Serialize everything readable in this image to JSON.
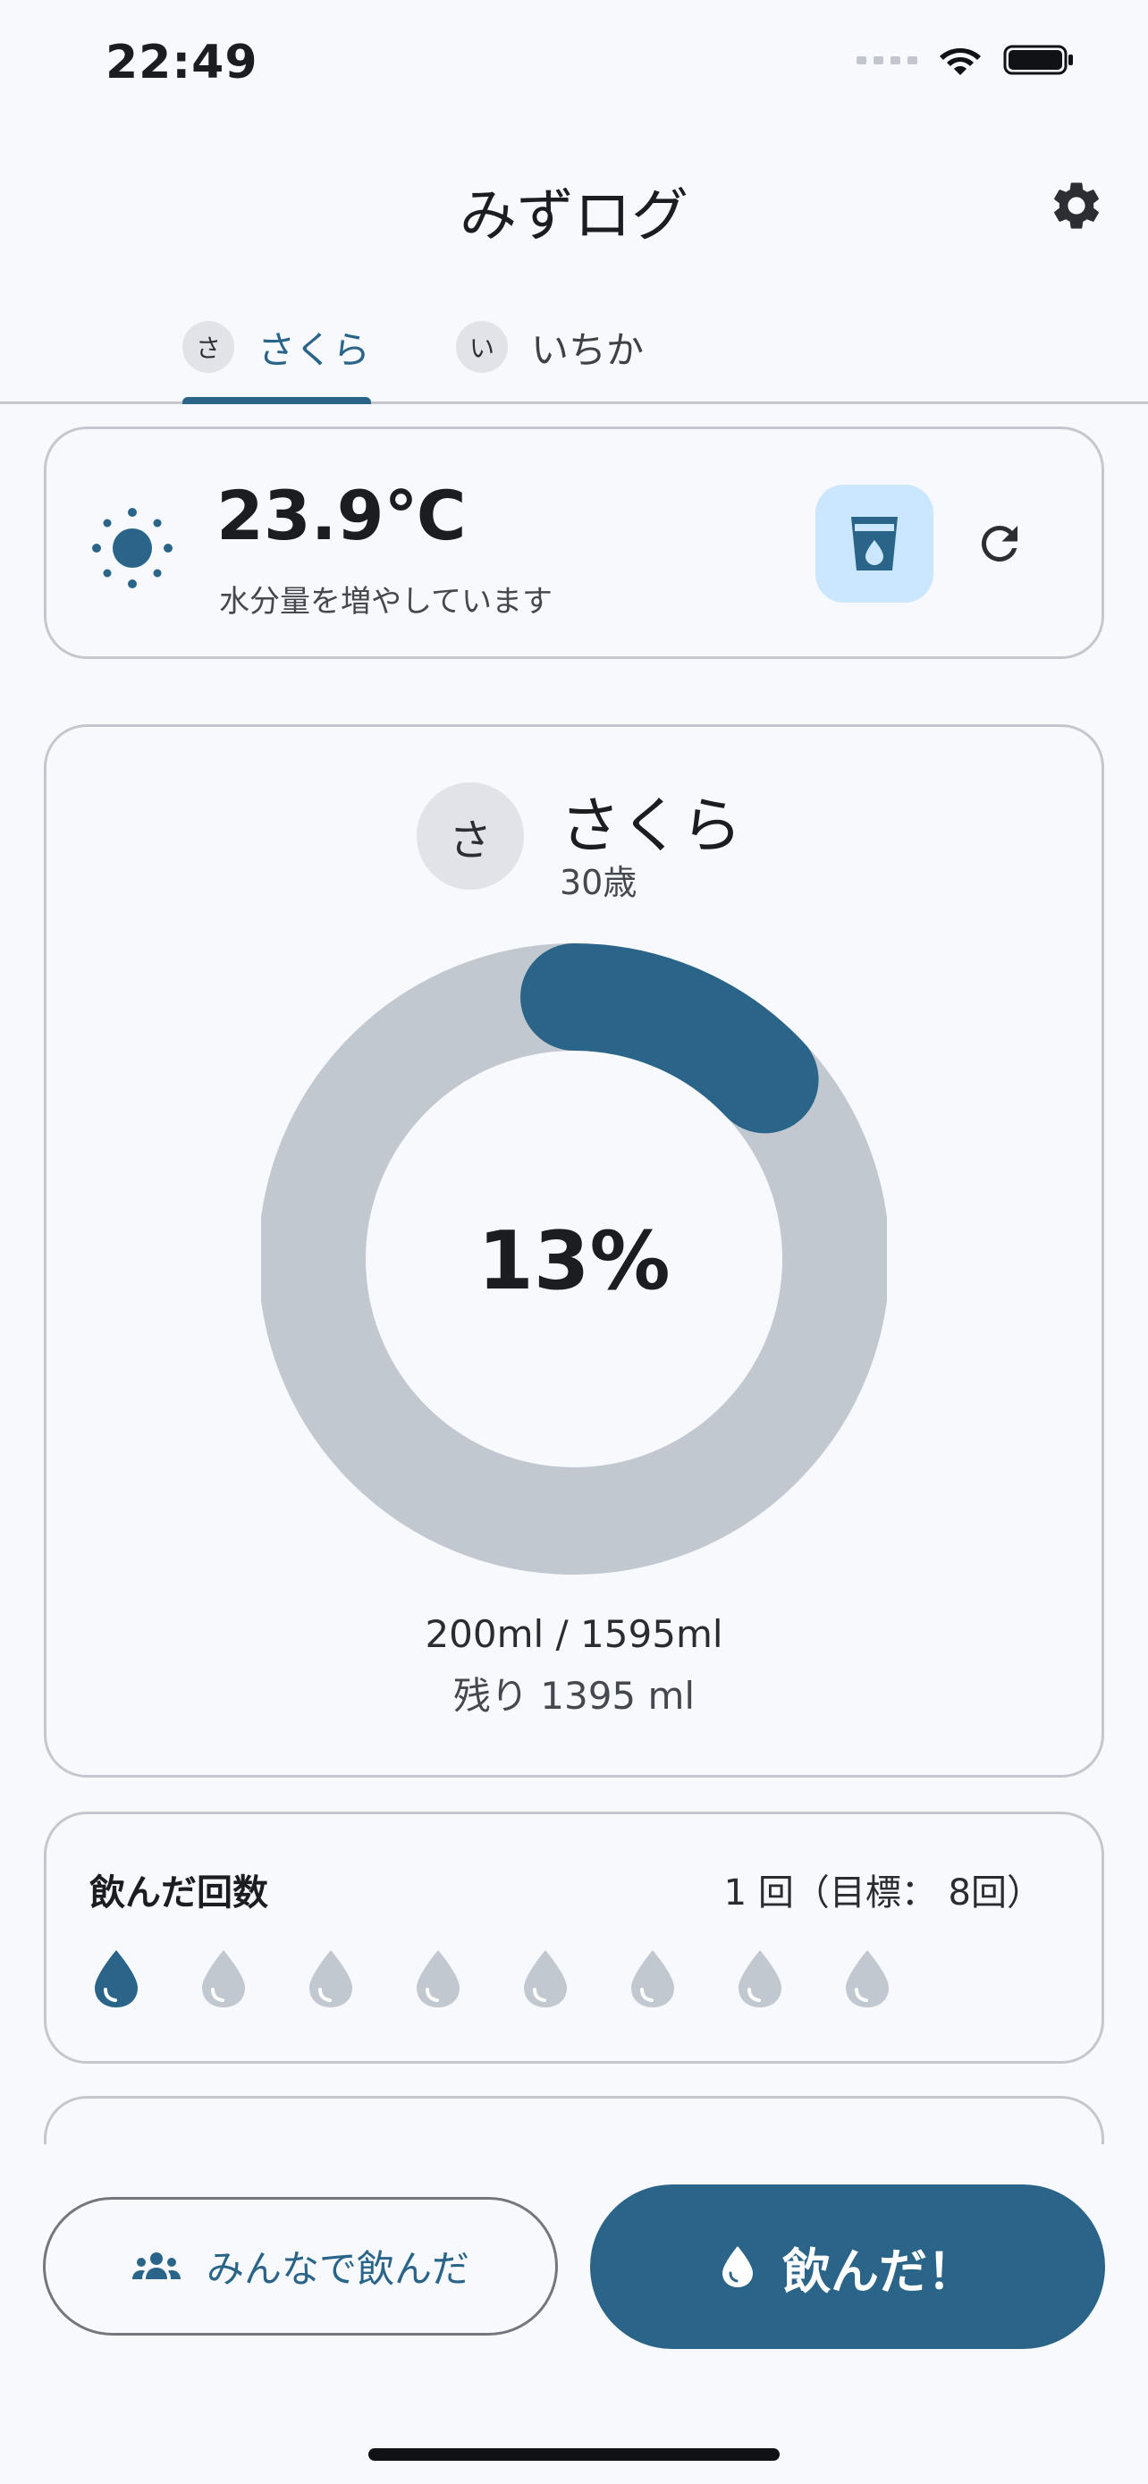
{
  "status_bar": {
    "time": "22:49"
  },
  "header": {
    "title": "みずログ"
  },
  "tabs": [
    {
      "avatar": "さ",
      "label": "さくら",
      "active": true
    },
    {
      "avatar": "い",
      "label": "いちか",
      "active": false
    }
  ],
  "weather": {
    "icon": "sun-icon",
    "temperature": "23.9℃",
    "message": "水分量を増やしています"
  },
  "progress": {
    "avatar": "さ",
    "name": "さくら",
    "age": "30歳",
    "percent_label": "13%",
    "percent_value": 0.13,
    "amount": "200ml / 1595ml",
    "remaining": "残り 1395 ml"
  },
  "drink_count": {
    "title": "飲んだ回数",
    "value": "1 回（目標： 8回）",
    "done": 1,
    "goal": 8
  },
  "actions": {
    "together_label": "みんなで飲んだ",
    "drank_label": "飲んだ！"
  },
  "colors": {
    "accent": "#2a6589",
    "ring_track": "#c2c8cf",
    "cup_bg": "#cbe6ff",
    "drop_empty": "#c2c8cf"
  }
}
